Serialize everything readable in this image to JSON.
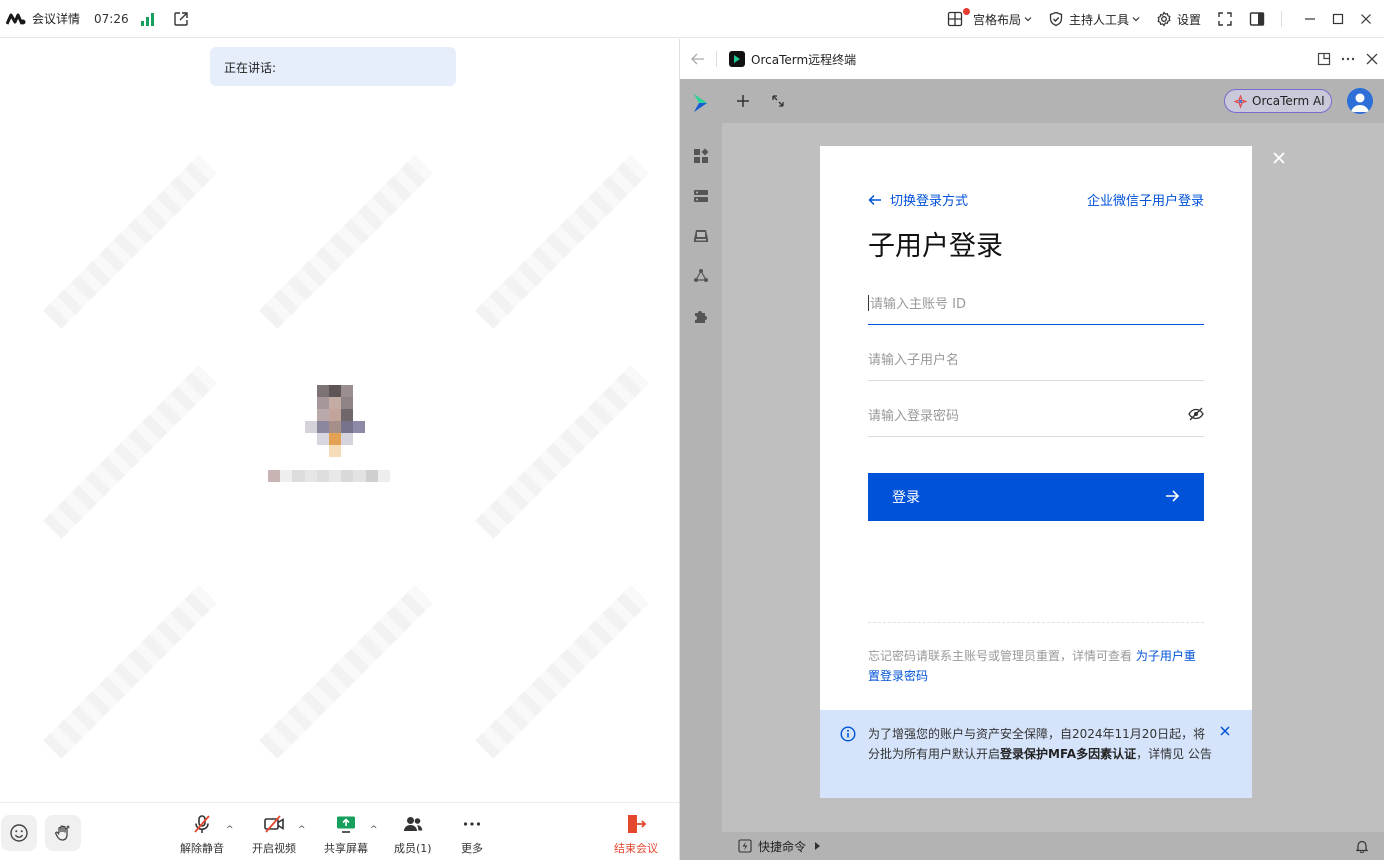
{
  "topbar": {
    "title": "会议详情",
    "timer": "07:26",
    "grid_layout": "宫格布局",
    "host_tools": "主持人工具",
    "settings": "设置"
  },
  "meeting": {
    "speaking_label": "正在讲话:",
    "toolbar": {
      "unmute": "解除静音",
      "start_video": "开启视频",
      "share_screen": "共享屏幕",
      "members": "成员(1)",
      "more": "更多",
      "end_meeting": "结束会议"
    }
  },
  "browser": {
    "tab_title": "OrcaTerm远程终端"
  },
  "orcaterm": {
    "ai_button": "OrcaTerm AI",
    "quick_commands": "快捷命令"
  },
  "login_modal": {
    "switch_method": "切换登录方式",
    "wecom_login": "企业微信子用户登录",
    "title": "子用户登录",
    "main_account_placeholder": "请输入主账号 ID",
    "sub_user_placeholder": "请输入子用户名",
    "password_placeholder": "请输入登录密码",
    "login_button": "登录",
    "forgot_text": "忘记密码请联系主账号或管理员重置，详情可查看",
    "forgot_link": "为子用户重置登录密码",
    "notice_pre": "为了增强您的账户与资产安全保障，自2024年11月20日起，将分批为所有用户默认开启",
    "notice_bold": "登录保护MFA多因素认证",
    "notice_post": "，详情见 公告"
  },
  "colors": {
    "primary_blue": "#0052d9",
    "end_red": "#e4472e",
    "signal_green": "#17a05d"
  }
}
